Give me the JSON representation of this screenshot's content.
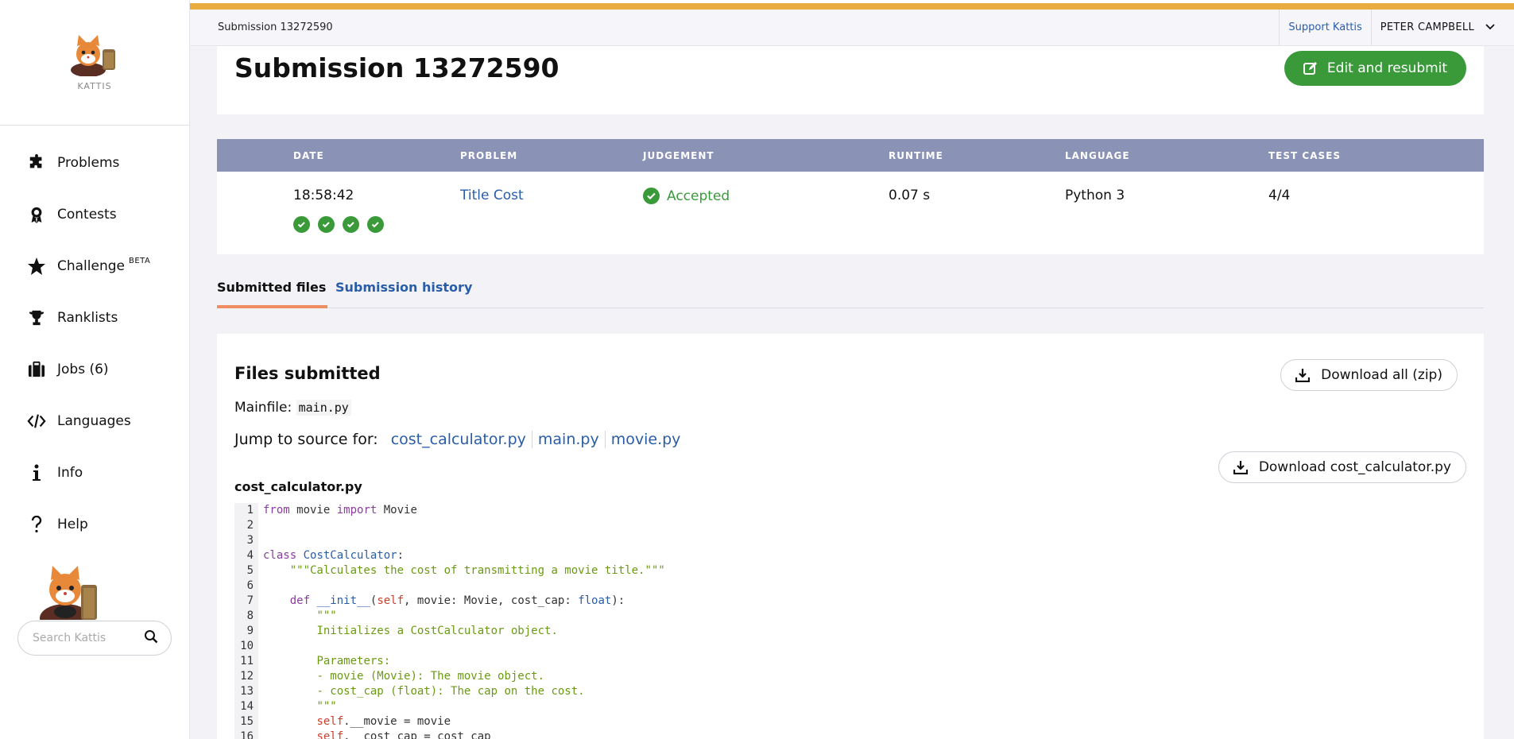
{
  "app": {
    "logo_text": "KATTIS",
    "breadcrumb": "Submission 13272590",
    "support_label": "Support Kattis",
    "user_name": "PETER CAMPBELL"
  },
  "sidebar": {
    "items": [
      {
        "label": "Problems",
        "icon": "puzzle-icon"
      },
      {
        "label": "Contests",
        "icon": "medal-icon"
      },
      {
        "label": "Challenge",
        "badge": "BETA",
        "icon": "star-icon"
      },
      {
        "label": "Ranklists",
        "icon": "trophy-icon"
      },
      {
        "label": "Jobs (6)",
        "icon": "briefcase-icon"
      },
      {
        "label": "Languages",
        "icon": "code-icon"
      },
      {
        "label": "Info",
        "icon": "info-icon"
      },
      {
        "label": "Help",
        "icon": "help-icon"
      }
    ],
    "search_placeholder": "Search Kattis"
  },
  "header": {
    "title": "Submission 13272590",
    "edit_button": "Edit and resubmit"
  },
  "submission_table": {
    "headers": [
      "DATE",
      "PROBLEM",
      "JUDGEMENT",
      "RUNTIME",
      "LANGUAGE",
      "TEST CASES"
    ],
    "row": {
      "date": "18:58:42",
      "problem": "Title Cost",
      "judgement": "Accepted",
      "runtime": "0.07 s",
      "language": "Python 3",
      "test_cases": "4/4"
    },
    "tests_passed": 4
  },
  "tabs": {
    "submitted_files": "Submitted files",
    "submission_history": "Submission history"
  },
  "files": {
    "title": "Files submitted",
    "download_all": "Download all (zip)",
    "mainfile_label": "Mainfile:",
    "mainfile": "main.py",
    "jump_label": "Jump to source for:",
    "jump_links": [
      "cost_calculator.py",
      "main.py",
      "movie.py"
    ],
    "current_file": "cost_calculator.py",
    "download_file": "Download cost_calculator.py"
  },
  "colors": {
    "accent_green": "#3a9a3a",
    "link_blue": "#2a5da8",
    "table_header": "#8a92b6",
    "top_stripe": "#e8ad3e",
    "tab_underline": "#ee8e62"
  }
}
